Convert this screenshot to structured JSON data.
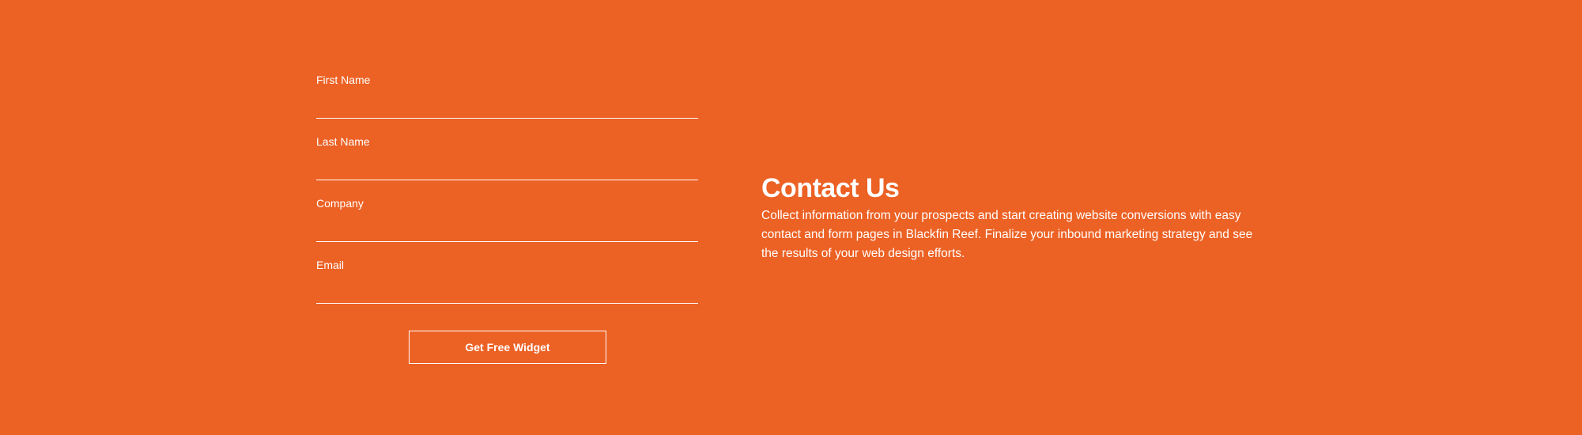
{
  "form": {
    "fields": [
      {
        "label": "First Name",
        "value": ""
      },
      {
        "label": "Last Name",
        "value": ""
      },
      {
        "label": "Company",
        "value": ""
      },
      {
        "label": "Email",
        "value": ""
      }
    ],
    "submit_label": "Get Free Widget"
  },
  "contact": {
    "title": "Contact Us",
    "body": "Collect information from your prospects and start creating website conversions with easy contact and form pages in Blackfin Reef. Finalize your inbound marketing strategy and see the results of your web design efforts."
  },
  "colors": {
    "background": "#ec6124",
    "text": "#ffffff"
  }
}
